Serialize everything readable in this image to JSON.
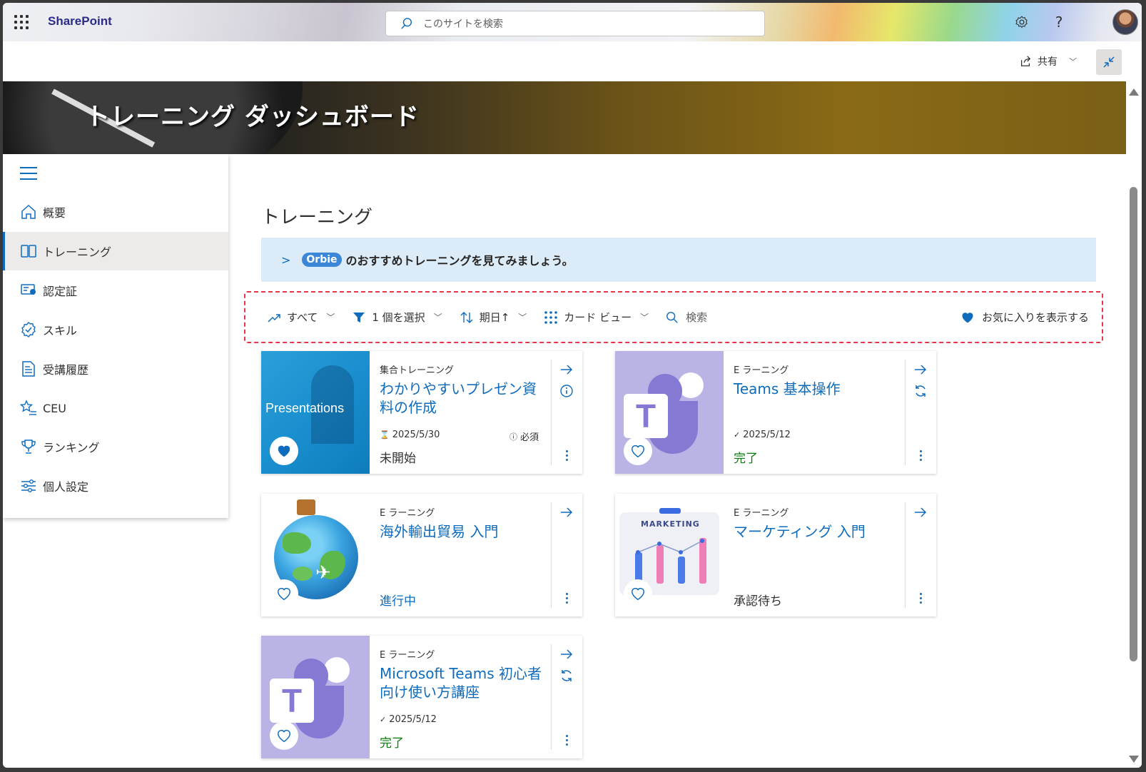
{
  "suitebar": {
    "brand": "SharePoint",
    "search_placeholder": "このサイトを検索",
    "help": "?"
  },
  "cmdbar": {
    "share_label": "共有"
  },
  "banner": {
    "title": "トレーニング ダッシュボード"
  },
  "nav": {
    "items": [
      {
        "label": "概要",
        "icon": "home-icon"
      },
      {
        "label": "トレーニング",
        "icon": "book-icon",
        "active": true
      },
      {
        "label": "認定証",
        "icon": "certificate-icon"
      },
      {
        "label": "スキル",
        "icon": "badge-icon"
      },
      {
        "label": "受講履歴",
        "icon": "document-list-icon"
      },
      {
        "label": "CEU",
        "icon": "star-list-icon"
      },
      {
        "label": "ランキング",
        "icon": "trophy-icon"
      },
      {
        "label": "個人設定",
        "icon": "sliders-icon"
      }
    ]
  },
  "main": {
    "title": "トレーニング",
    "orbie_badge": "Orbie",
    "orbie_text": "のおすすめトレーニングを見てみましょう。",
    "filters": {
      "all": "すべて",
      "select": "1 個を選択",
      "sort": "期日↑",
      "view": "カード ビュー",
      "search": "検索",
      "favorites": "お気に入りを表示する"
    },
    "cards": [
      {
        "category": "集合トレーニング",
        "title": "わかりやすいプレゼン資料の作成",
        "date": "2025/5/30",
        "required": "必須",
        "status": "未開始",
        "thumb_text": "Presentations",
        "favorite": true
      },
      {
        "category": "E ラーニング",
        "title": "Teams 基本操作",
        "date": "2025/5/12",
        "status": "完了",
        "favorite": false
      },
      {
        "category": "E ラーニング",
        "title": "海外輸出貿易 入門",
        "status": "進行中",
        "favorite": false
      },
      {
        "category": "E ラーニング",
        "title": "マーケティング 入門",
        "status": "承認待ち",
        "thumb_text": "MARKETING",
        "favorite": false
      },
      {
        "category": "E ラーニング",
        "title": "Microsoft Teams 初心者向け使い方講座",
        "date": "2025/5/12",
        "status": "完了",
        "favorite": false
      }
    ]
  },
  "colors": {
    "accent": "#0f6cbd",
    "complete": "#0b7a0b",
    "highlight_border": "#e8374a"
  }
}
